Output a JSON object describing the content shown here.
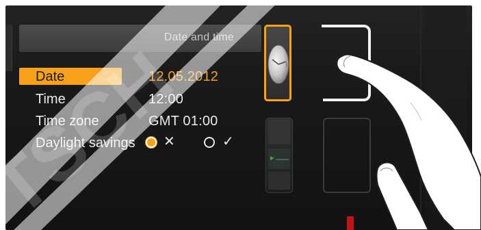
{
  "header": {
    "title": "Date and time"
  },
  "settings": {
    "date": {
      "label": "Date",
      "value": "12.05.2012"
    },
    "time": {
      "label": "Time",
      "value": "12:00"
    },
    "timezone": {
      "label": "Time zone",
      "value": "GMT 01:00"
    },
    "dst": {
      "label": "Daylight savings",
      "option_off_symbol": "✕",
      "option_on_symbol": "✓",
      "selected": "off"
    }
  },
  "icons": {
    "clock_tab": "clock-icon",
    "other_tab": "display-icon"
  },
  "colors": {
    "accent": "#f7a21a",
    "text": "#e9e9e9",
    "background": "#1a1a1a"
  }
}
